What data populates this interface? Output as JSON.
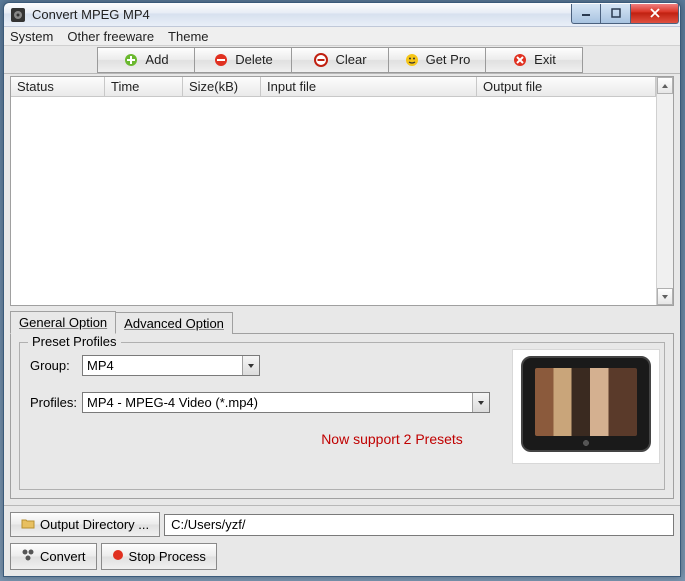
{
  "window": {
    "title": "Convert MPEG MP4"
  },
  "menu": {
    "system": "System",
    "freeware": "Other freeware",
    "theme": "Theme"
  },
  "toolbar": {
    "add": "Add",
    "delete": "Delete",
    "clear": "Clear",
    "getpro": "Get Pro",
    "exit": "Exit"
  },
  "columns": {
    "status": "Status",
    "time": "Time",
    "size": "Size(kB)",
    "input": "Input file",
    "output": "Output file"
  },
  "tabs": {
    "general": "General Option",
    "advanced": "Advanced Option"
  },
  "preset": {
    "legend": "Preset Profiles",
    "group_label": "Group:",
    "group_value": "MP4",
    "profiles_label": "Profiles:",
    "profiles_value": "MP4 - MPEG-4 Video (*.mp4)",
    "support_msg": "Now support 2 Presets"
  },
  "output": {
    "button": "Output Directory ...",
    "path": "C:/Users/yzf/"
  },
  "actions": {
    "convert": "Convert",
    "stop": "Stop Process"
  }
}
